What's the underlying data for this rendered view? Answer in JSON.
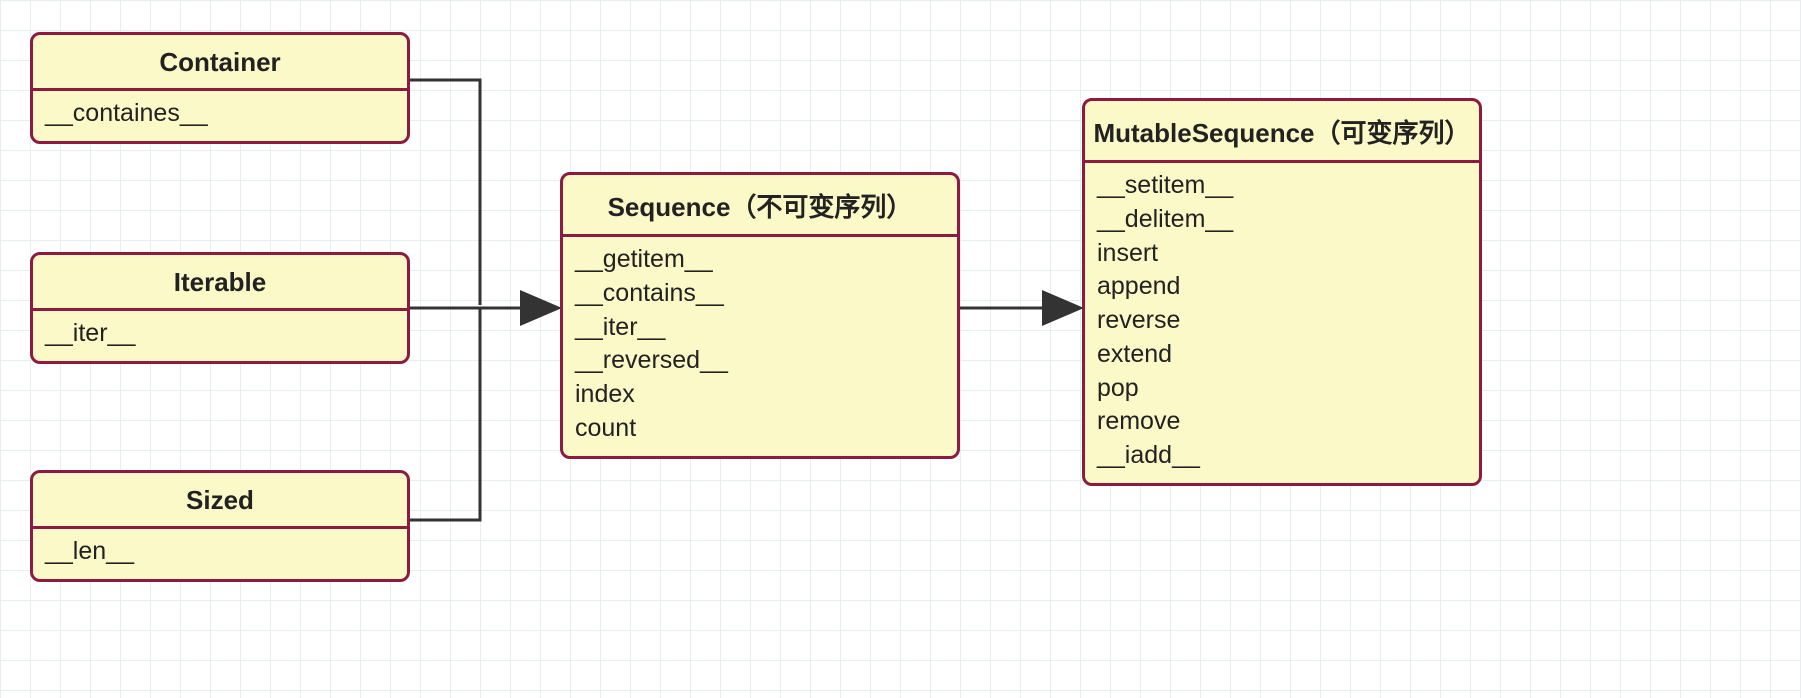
{
  "boxes": {
    "container": {
      "title": "Container",
      "methods": [
        "__containes__"
      ]
    },
    "iterable": {
      "title": "Iterable",
      "methods": [
        "__iter__"
      ]
    },
    "sized": {
      "title": "Sized",
      "methods": [
        "__len__"
      ]
    },
    "sequence": {
      "title": "Sequence（不可变序列）",
      "methods": [
        "__getitem__",
        "__contains__",
        "__iter__",
        "__reversed__",
        "index",
        "count"
      ]
    },
    "mutable": {
      "title": "MutableSequence（可变序列）",
      "methods": [
        "__setitem__",
        "__delitem__",
        "insert",
        "append",
        "reverse",
        "extend",
        "pop",
        "remove",
        "__iadd__"
      ]
    }
  }
}
